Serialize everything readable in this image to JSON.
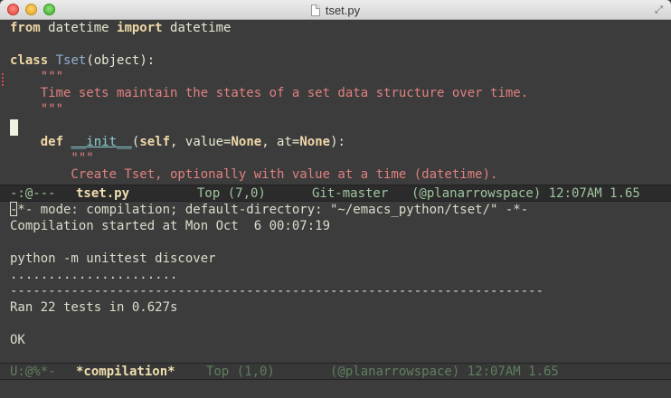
{
  "window": {
    "title": "tset.py",
    "icons": [
      "close-button",
      "minimize-button",
      "zoom-button",
      "document-icon",
      "fullscreen-icon"
    ]
  },
  "editor": {
    "line1": {
      "kw1": "from",
      "mid": " datetime ",
      "kw2": "import",
      "end": " datetime"
    },
    "line2": {
      "kw": "class",
      "sp": " ",
      "cls": "Tset",
      "end": "(object):"
    },
    "line3": "    \"\"\"",
    "line4": "    Time sets maintain the states of a set data structure over time.",
    "line5": "    \"\"\"",
    "line6": {
      "indent": "    ",
      "kw": "def",
      "sp": " ",
      "fn": "__init__",
      "a": "(",
      "self": "self",
      "b": ", value=",
      "none1": "None",
      "c": ", at=",
      "none2": "None",
      "d": "):"
    },
    "line7": "        \"\"\"",
    "line8": "        Create Tset, optionally with value at a time (datetime)."
  },
  "modeline_active": {
    "status": "-:@---",
    "buffer": "tset.py",
    "position": "Top (7,0)",
    "vc": "Git-master",
    "mode": "(@planarrowspace) 12:07AM 1.65"
  },
  "compilation": {
    "line1": "-*- mode: compilation; default-directory: \"~/emacs_python/tset/\" -*-",
    "line2": "Compilation started at Mon Oct  6 00:07:19",
    "line3": "",
    "line4": "python -m unittest discover",
    "line5": "......................",
    "line6": "----------------------------------------------------------------------",
    "line7": "Ran 22 tests in 0.627s",
    "line8": "",
    "line9": "OK"
  },
  "modeline_inactive": {
    "status": "U:@%*-",
    "buffer": "*compilation*",
    "position": "Top (1,0)",
    "mode": "(@planarrowspace) 12:07AM 1.65"
  },
  "colors": {
    "background": "#3c3c3c",
    "keyword": "#f0d8a8",
    "class": "#8fb0d0",
    "string": "#e08080",
    "function": "#8cd0d3",
    "modeline_text": "#9fc59f",
    "buffer_name": "#f0dfaf"
  }
}
